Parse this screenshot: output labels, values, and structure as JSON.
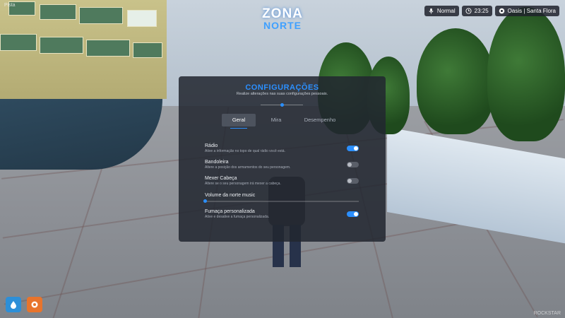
{
  "corner_label": "Pista",
  "watermark": "ROCKSTAR",
  "logo": {
    "top": "ZONA",
    "bottom": "NORTE"
  },
  "hud": {
    "mode": "Normal",
    "time": "23:25",
    "location": "Oasis | Santa Flora",
    "colors": {
      "bg": "#1e222c",
      "text": "#ffffff"
    }
  },
  "settings": {
    "title": "CONFIGURAÇÕES",
    "subtitle": "Realize alterações nas suas configurações pessoais.",
    "accent": "#2b8fff",
    "tabs": [
      {
        "label": "Geral",
        "active": true
      },
      {
        "label": "Mira",
        "active": false
      },
      {
        "label": "Desempenho",
        "active": false
      }
    ],
    "options": [
      {
        "title": "Rádio",
        "description": "Ative a informação no topo de qual rádio você está.",
        "enabled": true
      },
      {
        "title": "Bandoleira",
        "description": "Altere a posição dos armamentos do seu personagem.",
        "enabled": false
      },
      {
        "title": "Mexer Cabeça",
        "description": "Altere se o seu personagem irá mexer a cabeça.",
        "enabled": false
      }
    ],
    "volume": {
      "title": "Volume da norte music",
      "level": 0.0
    },
    "smoke": {
      "title": "Fumaça personalizada",
      "description": "Ative e desative a fumaça personalizada.",
      "enabled": true
    }
  },
  "quick_buttons": [
    {
      "icon": "water-drop-icon",
      "color": "#2d8fd8"
    },
    {
      "icon": "hunger-icon",
      "color": "#e8742c"
    }
  ]
}
